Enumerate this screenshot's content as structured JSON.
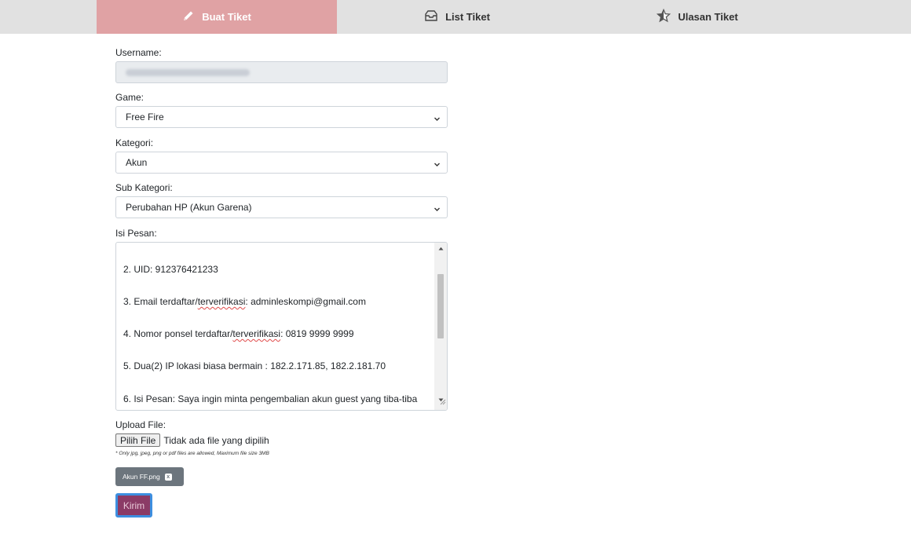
{
  "tabs": {
    "create": "Buat Tiket",
    "list": "List Tiket",
    "review": "Ulasan Tiket"
  },
  "form": {
    "username_label": "Username:",
    "game_label": "Game:",
    "game_value": "Free Fire",
    "category_label": "Kategori:",
    "category_value": "Akun",
    "subcategory_label": "Sub Kategori:",
    "subcategory_value": "Perubahan HP (Akun Garena)",
    "message_label": "Isi Pesan:",
    "message_lines": {
      "l2": "2. UID:  912376421233",
      "l3a": "3. Email terdaftar/",
      "l3b": "terverifikasi",
      "l3c": ":  adminleskompi@gmail.com",
      "l4a": "4. Nomor ponsel terdaftar/",
      "l4b": "terverifikasi",
      "l4c": ":   0819 9999 9999",
      "l5": "5. Dua(2) IP lokasi biasa bermain : 182.2.171.85, 182.2.181.70",
      "l6": "6. Isi Pesan: Saya ingin minta pengembalian akun guest yang tiba-tiba"
    },
    "upload_label": "Upload File:",
    "upload_button": "Pilih File",
    "upload_status": "Tidak ada file yang dipilih",
    "upload_hint": "* Only jpg, jpeg, png or pdf files are allowed, Maximum file size 3MB",
    "attached_file": "Akun FF.png",
    "attached_remove": "x",
    "submit_label": "Kirim"
  },
  "colors": {
    "active_tab": "#e0a2a4",
    "tabbar": "#e1e1e1",
    "submit_bg": "#8b3b66",
    "submit_border": "#3d8fe0",
    "chip": "#6c757d"
  },
  "icons": {
    "create": "pencil-icon",
    "list": "inbox-icon",
    "review": "star-icon"
  }
}
